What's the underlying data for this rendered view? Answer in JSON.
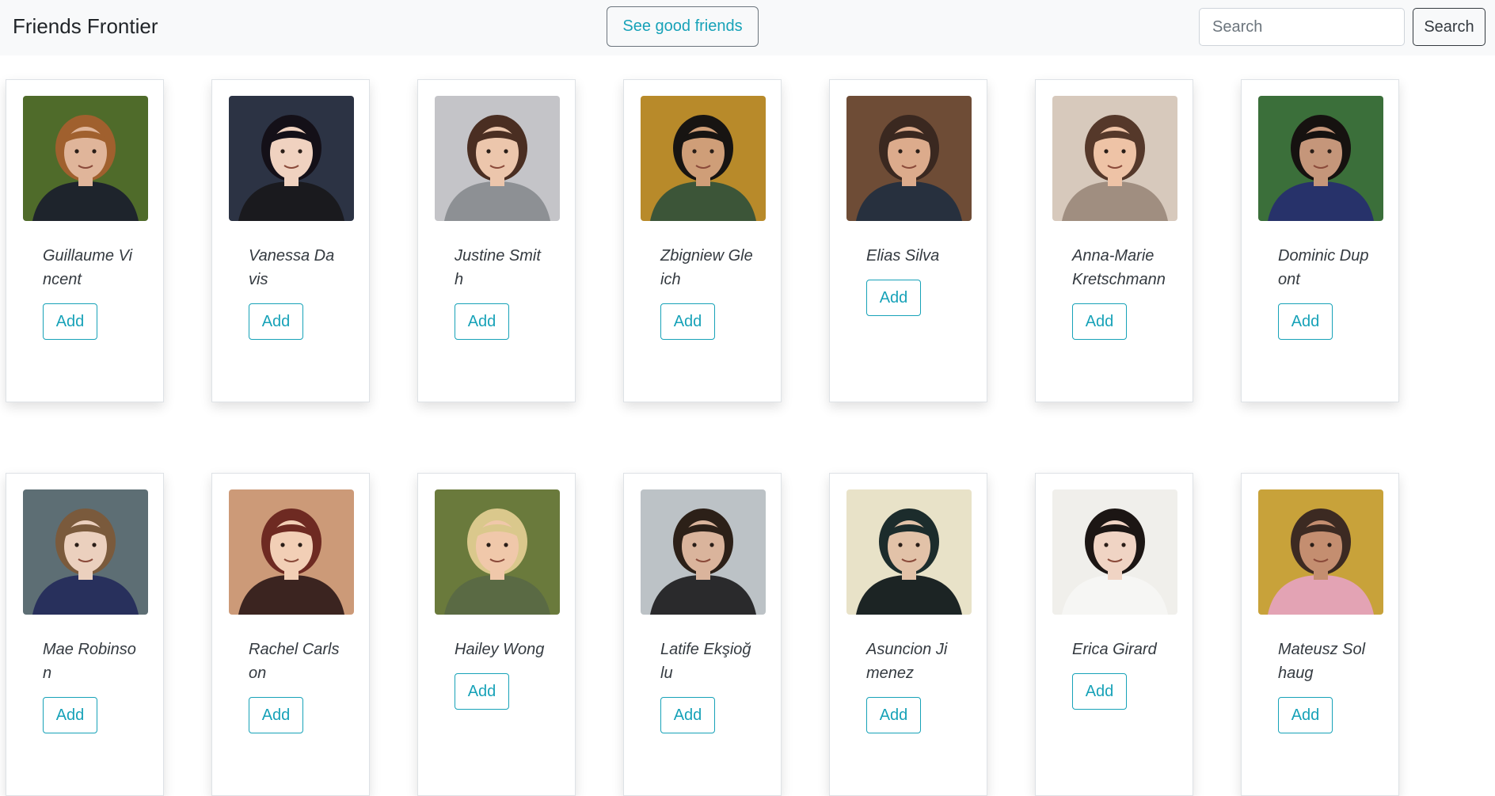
{
  "navbar": {
    "brand": "Friends Frontier",
    "good_friends_button": "See good friends",
    "search_placeholder": "Search",
    "search_button": "Search"
  },
  "colors": {
    "accent": "#17a2b8",
    "navbar_bg": "#f8f9fa"
  },
  "friends": [
    {
      "name": "Guillaume Vincent",
      "add_label": "Add",
      "photo": "man-red-beard-suit",
      "bg": "#4f6b2a",
      "skin": "#e0b59a",
      "hair": "#a0602e",
      "shirt": "#1e242c"
    },
    {
      "name": "Vanessa Davis",
      "add_label": "Add",
      "photo": "woman-dark-hair",
      "bg": "#2c3344",
      "skin": "#f0d2c0",
      "hair": "#141018",
      "shirt": "#1a1a1e"
    },
    {
      "name": "Justine Smith",
      "add_label": "Add",
      "photo": "woman-surprised",
      "bg": "#c4c4c8",
      "skin": "#ecc6ac",
      "hair": "#4a2e22",
      "shirt": "#8d9094"
    },
    {
      "name": "Zbigniew Gleich",
      "add_label": "Add",
      "photo": "man-autumn-jacket",
      "bg": "#b88a2a",
      "skin": "#cf9e78",
      "hair": "#171412",
      "shirt": "#3c5538"
    },
    {
      "name": "Elias Silva",
      "add_label": "Add",
      "photo": "man-wood-wall",
      "bg": "#6e4c36",
      "skin": "#dcab8c",
      "hair": "#3a2820",
      "shirt": "#27303e"
    },
    {
      "name": "Anna-Marie Kretschmann",
      "add_label": "Add",
      "photo": "woman-smiling",
      "bg": "#d7c9bc",
      "skin": "#eec3a6",
      "hair": "#55382a",
      "shirt": "#a08e80"
    },
    {
      "name": "Dominic Dupont",
      "add_label": "Add",
      "photo": "man-blue-shirt",
      "bg": "#3b6f3a",
      "skin": "#c5967a",
      "hair": "#161210",
      "shirt": "#27326a"
    },
    {
      "name": "Mae Robinson",
      "add_label": "Add",
      "photo": "woman-blue-dress",
      "bg": "#5d6e74",
      "skin": "#ebd0be",
      "hair": "#7a5a3c",
      "shirt": "#28305c"
    },
    {
      "name": "Rachel Carlson",
      "add_label": "Add",
      "photo": "woman-red-hair",
      "bg": "#cc9a78",
      "skin": "#f2cfb6",
      "hair": "#6e2a22",
      "shirt": "#3b2420"
    },
    {
      "name": "Hailey Wong",
      "add_label": "Add",
      "photo": "woman-blonde",
      "bg": "#6a7a3c",
      "skin": "#f0c8aa",
      "hair": "#dac88c",
      "shirt": "#5a6a44"
    },
    {
      "name": "Latife Ekşioğlu",
      "add_label": "Add",
      "photo": "woman-long-dark-hair",
      "bg": "#bcc2c6",
      "skin": "#dab49c",
      "hair": "#2c2018",
      "shirt": "#2a2a2c"
    },
    {
      "name": "Asuncion Jimenez",
      "add_label": "Add",
      "photo": "woman-teal-light",
      "bg": "#e8e2c8",
      "skin": "#e2c2a8",
      "hair": "#1c2c2c",
      "shirt": "#1c2424"
    },
    {
      "name": "Erica Girard",
      "add_label": "Add",
      "photo": "woman-short-hair",
      "bg": "#f0efeb",
      "skin": "#f0d4c4",
      "hair": "#1c1614",
      "shirt": "#f6f6f4"
    },
    {
      "name": "Mateusz Solhaug",
      "add_label": "Add",
      "photo": "man-pink-shirt",
      "bg": "#c8a23a",
      "skin": "#c48e70",
      "hair": "#3c2a22",
      "shirt": "#e3a3b4"
    }
  ]
}
